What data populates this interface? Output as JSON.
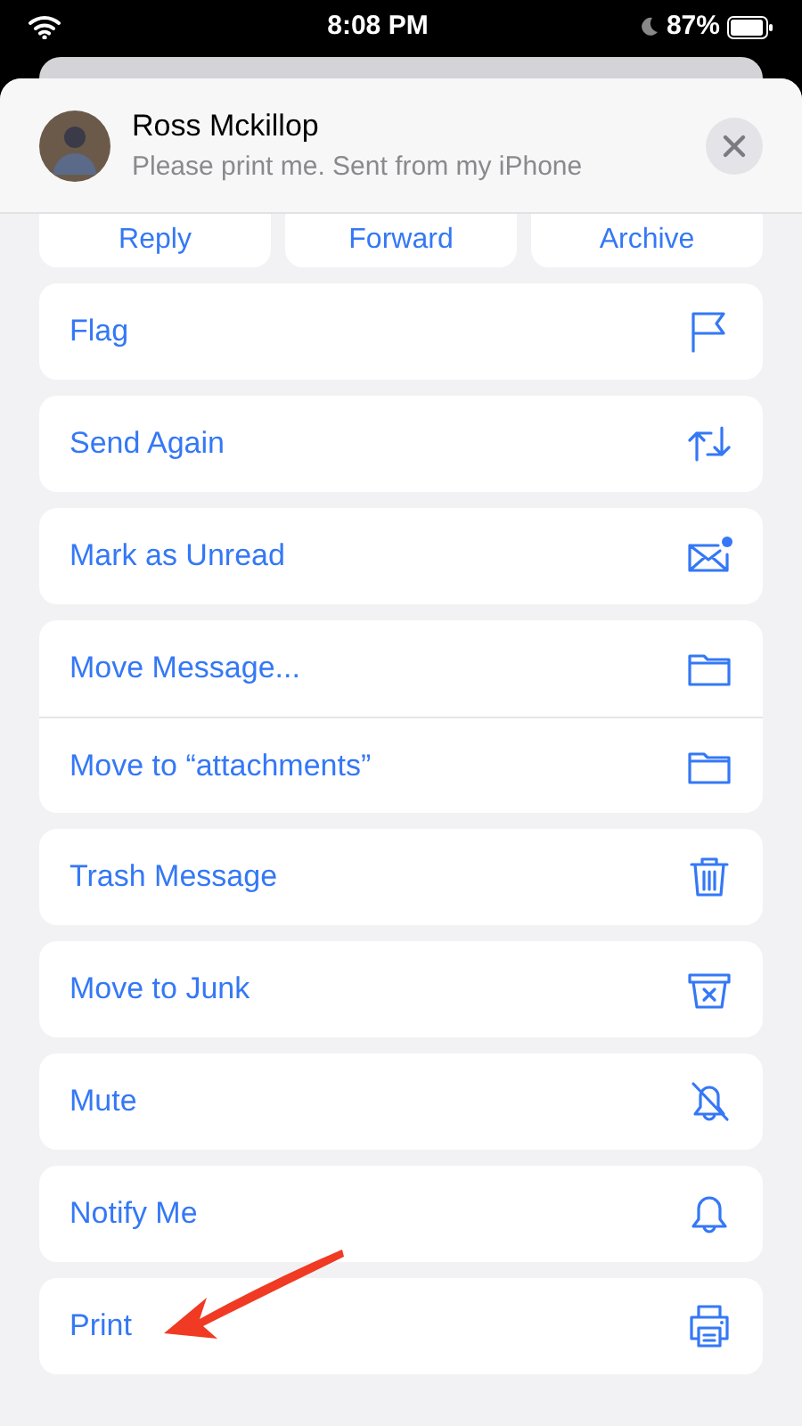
{
  "status_bar": {
    "time": "8:08 PM",
    "battery": "87%"
  },
  "header": {
    "sender": "Ross Mckillop",
    "preview": "Please print me. Sent from my iPhone"
  },
  "quick_actions": [
    "Reply",
    "Forward",
    "Archive"
  ],
  "groups": [
    [
      {
        "label": "Flag",
        "kind": "flag"
      }
    ],
    [
      {
        "label": "Send Again",
        "kind": "send-again"
      }
    ],
    [
      {
        "label": "Mark as Unread",
        "kind": "unread"
      }
    ],
    [
      {
        "label": "Move Message...",
        "kind": "folder"
      },
      {
        "label": "Move to “attachments”",
        "kind": "folder"
      }
    ],
    [
      {
        "label": "Trash Message",
        "kind": "trash"
      }
    ],
    [
      {
        "label": "Move to Junk",
        "kind": "junk"
      }
    ],
    [
      {
        "label": "Mute",
        "kind": "mute"
      }
    ],
    [
      {
        "label": "Notify Me",
        "kind": "bell"
      }
    ],
    [
      {
        "label": "Print",
        "kind": "print"
      }
    ]
  ]
}
